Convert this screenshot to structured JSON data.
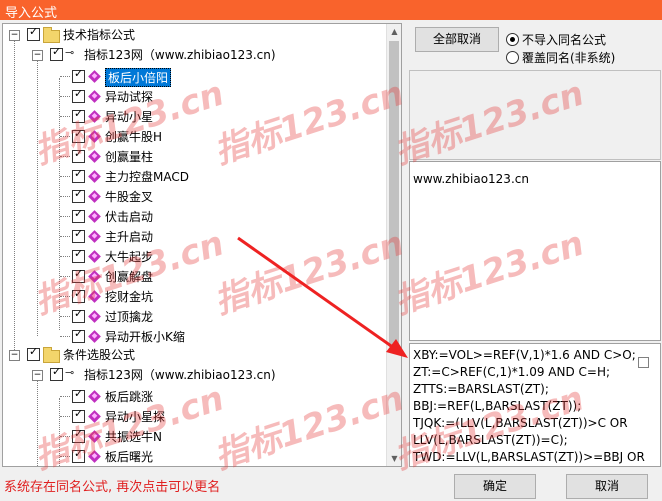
{
  "window": {
    "title": "导入公式"
  },
  "tree": {
    "groups": [
      {
        "label": "技术指标公式",
        "site": "指标123网（www.zhibiao123.cn)",
        "items": [
          "板后小倍阳",
          "异动试探",
          "异动小星",
          "创赢牛股H",
          "创赢量柱",
          "主力控盘MACD",
          "牛股金叉",
          "伏击启动",
          "主升启动",
          "大牛起步",
          "创赢解盘",
          "挖财金坑",
          "过顶擒龙",
          "异动开板小K缩"
        ]
      },
      {
        "label": "条件选股公式",
        "site": "指标123网（www.zhibiao123.cn)",
        "items": [
          "板后跳涨",
          "异动小星探",
          "共振选牛N",
          "板后曙光"
        ]
      }
    ]
  },
  "right": {
    "cancel_all_label": "全部取消",
    "radio_skip_label": "不导入同名公式",
    "radio_overwrite_label": "覆盖同名(非系统)",
    "info_text": "www.zhibiao123.cn",
    "code_lines": [
      "XBY:=VOL>=REF(V,1)*1.6 AND C>O;",
      "ZT:=C>REF(C,1)*1.09 AND C=H;",
      "ZTTS:=BARSLAST(ZT);",
      "BBJ:=REF(L,BARSLAST(ZT));",
      "TJQK:=(LLV(L,BARSLAST(ZT))>C OR",
      "LLV(L,BARSLAST(ZT))=C);",
      "TWD:=LLV(L,BARSLAST(ZT))>=BBJ OR"
    ]
  },
  "footer": {
    "status": "系统存在同名公式, 再次点击可以更名",
    "ok_label": "确定",
    "cancel_label": "取消"
  },
  "watermark": "指标123.cn",
  "colors": {
    "titlebar": "#f9632c",
    "selection": "#0078d7",
    "status": "#e02020",
    "arrow": "#ee2222"
  }
}
